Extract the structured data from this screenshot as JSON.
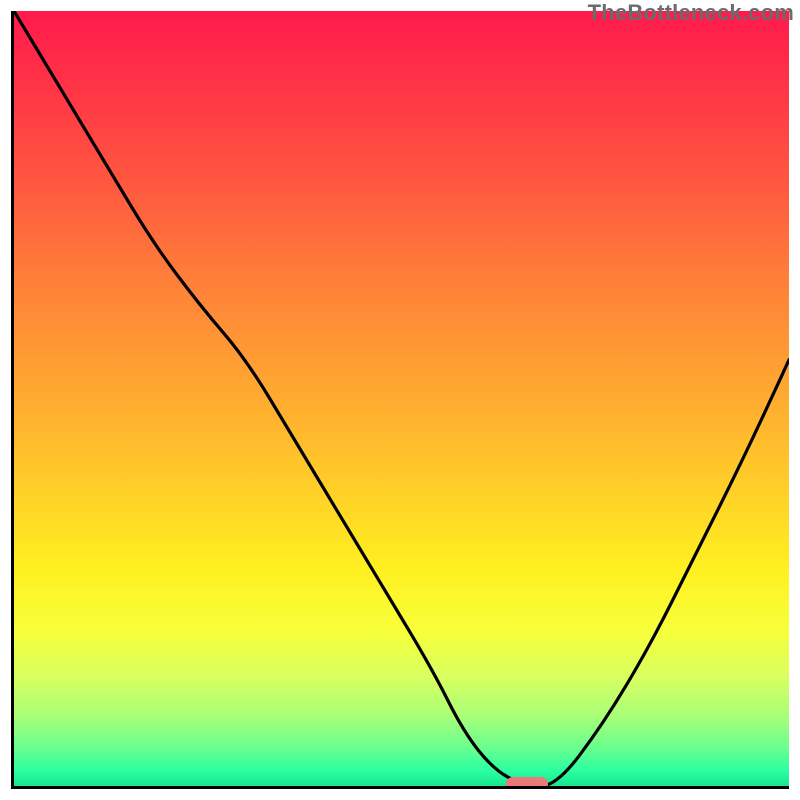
{
  "watermark": {
    "text": "TheBottleneck.com"
  },
  "chart_data": {
    "type": "line",
    "title": "",
    "xlabel": "",
    "ylabel": "",
    "x": [
      0.0,
      0.06,
      0.12,
      0.18,
      0.24,
      0.3,
      0.36,
      0.42,
      0.48,
      0.54,
      0.58,
      0.62,
      0.66,
      0.7,
      0.76,
      0.82,
      0.88,
      0.94,
      1.0
    ],
    "values": [
      1.0,
      0.9,
      0.8,
      0.7,
      0.62,
      0.55,
      0.45,
      0.35,
      0.25,
      0.15,
      0.07,
      0.02,
      0.0,
      0.0,
      0.08,
      0.18,
      0.3,
      0.42,
      0.55
    ],
    "xlim": [
      0,
      1
    ],
    "ylim": [
      0,
      1
    ],
    "marker": {
      "x": 0.66,
      "y": 0.0,
      "color": "#ea7a7a"
    },
    "background": {
      "type": "vertical-gradient",
      "stops": [
        {
          "pos": 0.0,
          "color": "#ff1a4d"
        },
        {
          "pos": 0.5,
          "color": "#ffab30"
        },
        {
          "pos": 0.8,
          "color": "#f7ff3a"
        },
        {
          "pos": 1.0,
          "color": "#17e890"
        }
      ]
    }
  }
}
